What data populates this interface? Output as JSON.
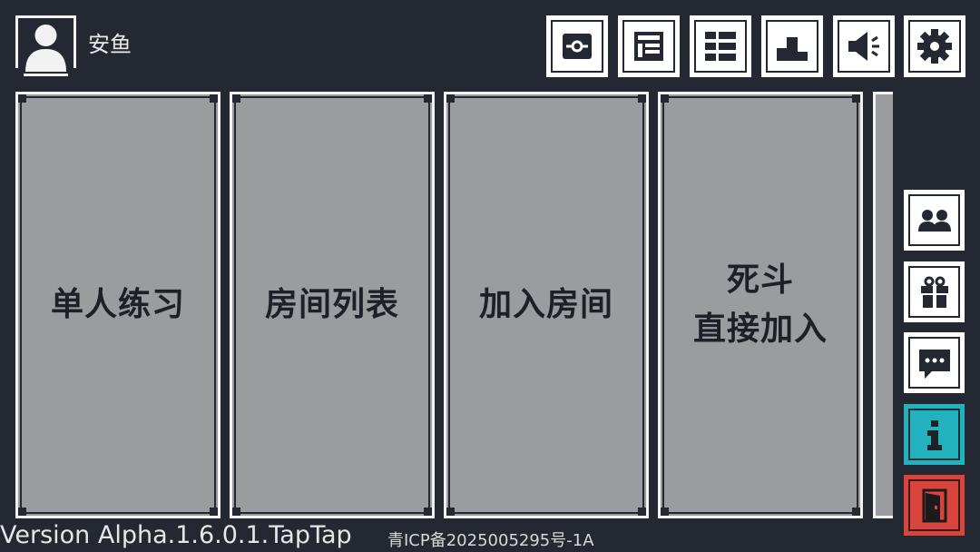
{
  "user": {
    "avatar_icon": "user-avatar-icon",
    "name": "安鱼"
  },
  "top_buttons": [
    {
      "id": "capsule",
      "icon": "capsule-icon"
    },
    {
      "id": "notes",
      "icon": "notes-icon"
    },
    {
      "id": "list",
      "icon": "list-grid-icon"
    },
    {
      "id": "ranking",
      "icon": "podium-icon"
    },
    {
      "id": "sound",
      "icon": "speaker-icon"
    },
    {
      "id": "settings",
      "icon": "gear-icon"
    }
  ],
  "modes": [
    {
      "id": "solo",
      "lines": [
        "单人练习"
      ]
    },
    {
      "id": "room-list",
      "lines": [
        "房间列表"
      ]
    },
    {
      "id": "join-room",
      "lines": [
        "加入房间"
      ]
    },
    {
      "id": "deathmatch",
      "lines": [
        "死斗",
        "直接加入"
      ]
    }
  ],
  "side_buttons": [
    {
      "id": "friends",
      "icon": "friends-icon"
    },
    {
      "id": "gift",
      "icon": "gift-icon"
    },
    {
      "id": "chat",
      "icon": "chat-icon"
    },
    {
      "id": "info",
      "icon": "info-icon"
    },
    {
      "id": "exit",
      "icon": "exit-door-icon"
    }
  ],
  "footer": {
    "version": "Version Alpha.1.6.0.1.TapTap",
    "icp": "青ICP备2025005295号-1A"
  },
  "colors": {
    "background": "#232833",
    "panel": "#9a9ca0",
    "info_button": "#22b2bd",
    "exit_button": "#d9443d",
    "text_dark": "#1e2028"
  }
}
